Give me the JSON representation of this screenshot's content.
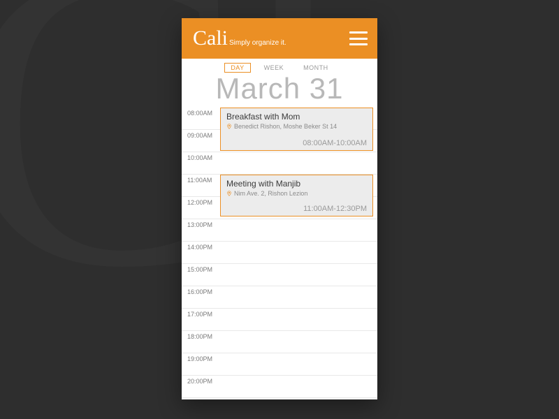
{
  "header": {
    "brand": "Cali",
    "tagline": "Simply organize it."
  },
  "tabs": {
    "day": "DAY",
    "week": "WEEK",
    "month": "MONTH"
  },
  "date_title": "March 31",
  "hours": [
    "08:00AM",
    "09:00AM",
    "10:00AM",
    "11:00AM",
    "12:00PM",
    "13:00PM",
    "14:00PM",
    "15:00PM",
    "16:00PM",
    "17:00PM",
    "18:00PM",
    "19:00PM",
    "20:00PM"
  ],
  "events": [
    {
      "title": "Breakfast with Mom",
      "location": "Benedict Rishon, Moshe Beker St 14",
      "time": "08:00AM-10:00AM"
    },
    {
      "title": "Meeting with Manjib",
      "location": "Nim Ave. 2, Rishon Lezion",
      "time": "11:00AM-12:30PM"
    }
  ],
  "colors": {
    "accent": "#eb8f24"
  }
}
